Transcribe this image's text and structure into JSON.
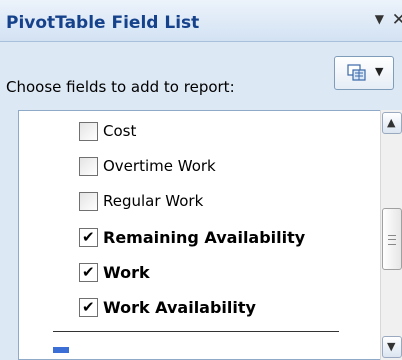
{
  "title_bar": {
    "title": "PivotTable Field List",
    "dropdown_glyph": "▼",
    "close_glyph": "✕"
  },
  "panel": {
    "choose_label": "Choose fields to add to report:",
    "layout_button": {
      "icon": "field-list-layout-icon",
      "arrow": "▼"
    }
  },
  "fields": [
    {
      "label": "Cost",
      "checked": false,
      "bold": false
    },
    {
      "label": "Overtime Work",
      "checked": false,
      "bold": false
    },
    {
      "label": "Regular Work",
      "checked": false,
      "bold": false
    },
    {
      "label": "Remaining Availability",
      "checked": true,
      "bold": true
    },
    {
      "label": "Work",
      "checked": true,
      "bold": true
    },
    {
      "label": "Work Availability",
      "checked": true,
      "bold": true
    }
  ],
  "checkmark_glyph": "✔",
  "scrollbar": {
    "up_glyph": "▲",
    "down_glyph": "▼"
  },
  "colors": {
    "title_text": "#15428b",
    "panel_bg": "#dde8f5",
    "list_bg": "#ffffff",
    "partial_icon": "#3b6fd6"
  }
}
